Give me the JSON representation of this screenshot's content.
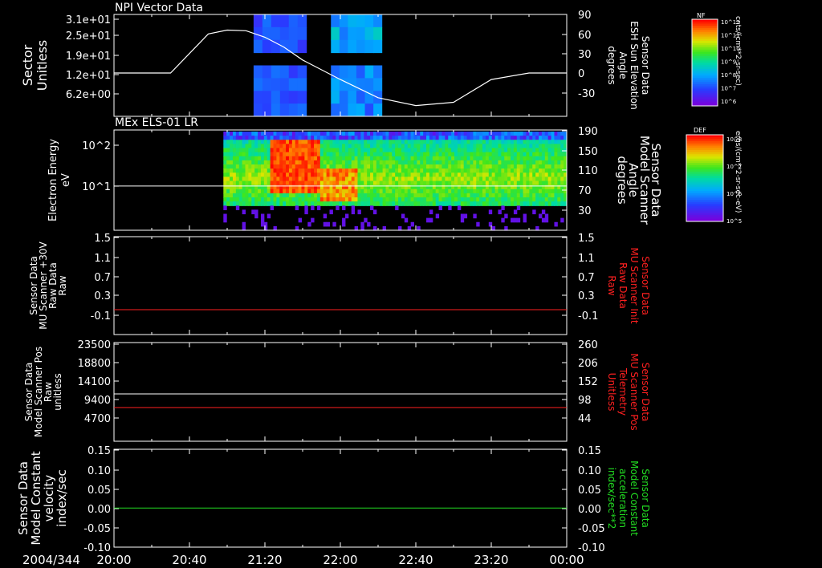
{
  "colors": {
    "white": "#ffffff",
    "red": "#ff2020",
    "green": "#22dd22"
  },
  "time_axis": {
    "date_label": "2004/344",
    "ticks": [
      "20:00",
      "20:40",
      "21:20",
      "22:00",
      "22:40",
      "23:20",
      "00:00"
    ]
  },
  "chart_data": [
    {
      "type": "heatmap",
      "title": "NPI Vector Data",
      "ylabel_lines": [
        "Sector",
        "Unitless"
      ],
      "y_ticks": [
        "3.1e+01",
        "2.5e+01",
        "1.9e+01",
        "1.2e+01",
        "6.2e+00"
      ],
      "data_blocks": [
        {
          "t_start": "21:14",
          "t_end": "21:42"
        },
        {
          "t_start": "21:55",
          "t_end": "22:22"
        }
      ],
      "overlay": {
        "ylabel_lines": [
          "Sensor Data",
          "ESH Sun Elevation",
          "Angle",
          "degrees"
        ],
        "y_ticks": [
          "90",
          "60",
          "30",
          "0",
          "-30"
        ],
        "ylim": [
          -60,
          90
        ],
        "x_min": [
          0,
          30,
          50,
          60,
          70,
          80,
          90,
          100,
          120,
          140,
          160,
          180,
          200,
          220,
          240
        ],
        "y": [
          0,
          0,
          60,
          66,
          65,
          55,
          40,
          20,
          -10,
          -38,
          -50,
          -45,
          -10,
          0,
          0
        ]
      },
      "colorbar": {
        "label": "NF",
        "ticks": [
          "10^12",
          "10^11",
          "10^10",
          "10^9",
          "10^8",
          "10^7",
          "10^6"
        ],
        "unit": "cnts/(cm**2-sr-sec)"
      }
    },
    {
      "type": "heatmap",
      "title": "MEx ELS-01 LR",
      "ylabel_lines": [
        "Electron Energy",
        "eV"
      ],
      "y_ticks": [
        "10^2",
        "10^1"
      ],
      "data_range": {
        "t_start": "20:58",
        "t_end": "00:00"
      },
      "overlay": {
        "ylabel_lines": [
          "Sensor Data",
          "Model Scanner",
          "Angle",
          "degrees"
        ],
        "y_ticks": [
          "190",
          "150",
          "110",
          "70",
          "30"
        ],
        "constant_value": 90
      },
      "colorbar": {
        "label": "DEF",
        "ticks": [
          "10^8",
          "10^7",
          "10^6",
          "10^5"
        ],
        "unit": "ergs/(cm**2-sr-sec-eV)"
      }
    },
    {
      "type": "line",
      "ylabel_lines": [
        "Sensor Data",
        "MU Scanner +30V",
        "Raw Data",
        "Raw"
      ],
      "y_ticks": [
        "1.5",
        "1.1",
        "0.7",
        "0.3",
        "-0.1"
      ],
      "right_ticks": [
        "1.5",
        "1.1",
        "0.7",
        "0.3",
        "-0.1"
      ],
      "ylim": [
        -0.5,
        1.5
      ],
      "right_label_lines": [
        "Sensor Data",
        "MU Scanner Init",
        "Raw Data",
        "Raw"
      ],
      "series": [
        {
          "name": "Sensor Data MU Scanner Init Raw Data Raw",
          "color": "red",
          "y_const": 0.0
        }
      ]
    },
    {
      "type": "line",
      "ylabel_lines": [
        "Sensor Data",
        "Model Scanner Pos",
        "Raw",
        "unitless"
      ],
      "y_ticks": [
        "23500",
        "18800",
        "14100",
        "9400",
        "4700"
      ],
      "right_ticks": [
        "260",
        "206",
        "152",
        "98",
        "44"
      ],
      "ylim": [
        0,
        23500
      ],
      "right_label_lines": [
        "Sensor Data",
        "MU Scanner Pos",
        "Telemetry",
        "Unitless"
      ],
      "series": [
        {
          "name": "Sensor Data Model Scanner Pos Raw unitless",
          "color": "white",
          "y_const": 11750
        },
        {
          "name": "Sensor Data MU Scanner Pos Telemetry Unitless",
          "color": "red",
          "y_const": 90
        }
      ]
    },
    {
      "type": "line",
      "ylabel_lines": [
        "Sensor Data",
        "Model Constant",
        "velocity",
        "index/sec"
      ],
      "y_ticks": [
        "0.15",
        "0.10",
        "0.05",
        "0.00",
        "-0.05",
        "-0.10"
      ],
      "right_ticks": [
        "0.15",
        "0.10",
        "0.05",
        "0.00",
        "-0.05",
        "-0.10"
      ],
      "ylim": [
        -0.1,
        0.15
      ],
      "right_label_lines": [
        "Sensor Data",
        "Model Constant",
        "acceleration",
        "index/sec**2"
      ],
      "series": [
        {
          "name": "Sensor Data Model Constant acceleration index/sec**2",
          "color": "green",
          "y_const": 0.0
        }
      ]
    }
  ]
}
